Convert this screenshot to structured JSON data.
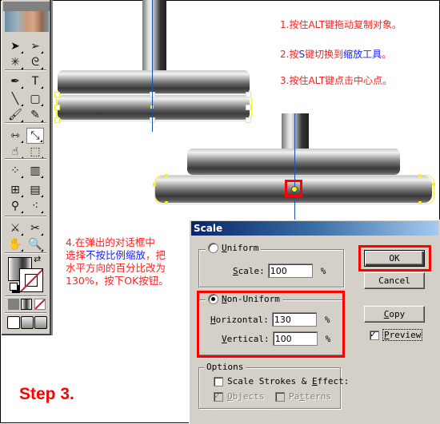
{
  "instructions": {
    "step1": "1.按住ALT键拖动复制对象。",
    "step2_prefix": "2.按",
    "step2_key": "S",
    "step2_mid": "键切换到",
    "step2_tool": "缩放工具",
    "step2_suffix": "。",
    "step3": "3.按住ALT键点击中心点。",
    "step4_line1": "4.在弹出的对话框中",
    "step4_line2_prefix": "选择",
    "step4_line2_highlight": "不按比例缩放",
    "step4_line2_suffix": "，把",
    "step4_line3": "水平方向的百分比改为",
    "step4_line4": "130%，按下OK按钮。"
  },
  "step_label": "Step 3.",
  "toolbox": {
    "tools": [
      {
        "name": "selection-tool",
        "glyph": "➤"
      },
      {
        "name": "direct-selection-tool",
        "glyph": "➢"
      },
      {
        "name": "magic-wand-tool",
        "glyph": "✳"
      },
      {
        "name": "lasso-tool",
        "glyph": "ᘓ"
      },
      {
        "name": "pen-tool",
        "glyph": "✒"
      },
      {
        "name": "type-tool",
        "glyph": "T"
      },
      {
        "name": "line-tool",
        "glyph": "╲"
      },
      {
        "name": "rounded-rectangle-tool",
        "glyph": "▢"
      },
      {
        "name": "paintbrush-tool",
        "glyph": "🖌"
      },
      {
        "name": "pencil-tool",
        "glyph": "✎"
      },
      {
        "name": "reflect-tool",
        "glyph": "⇿"
      },
      {
        "name": "scale-tool",
        "glyph": "⤡"
      },
      {
        "name": "warp-tool",
        "glyph": "☝"
      },
      {
        "name": "free-transform-tool",
        "glyph": "⬚"
      },
      {
        "name": "symbol-sprayer-tool",
        "glyph": "⁘"
      },
      {
        "name": "column-graph-tool",
        "glyph": "▥"
      },
      {
        "name": "mesh-tool",
        "glyph": "⊞"
      },
      {
        "name": "gradient-tool",
        "glyph": "▤"
      },
      {
        "name": "eyedropper-tool",
        "glyph": "⚲"
      },
      {
        "name": "blend-tool",
        "glyph": "⁖"
      },
      {
        "name": "slice-tool",
        "glyph": "⚔"
      },
      {
        "name": "scissors-tool",
        "glyph": "✂"
      },
      {
        "name": "hand-tool",
        "glyph": "✋"
      },
      {
        "name": "zoom-tool",
        "glyph": "🔍"
      }
    ],
    "active_tool": "scale-tool"
  },
  "dialog": {
    "title": "Scale",
    "uniform": {
      "label_u": "U",
      "label_rest": "niform",
      "selected": false,
      "scale_label_u": "S",
      "scale_label_rest": "cale:",
      "scale_value": "100",
      "unit": "%"
    },
    "non_uniform": {
      "label_u": "N",
      "label_rest": "on-Uniform",
      "selected": true,
      "horizontal_label_u": "H",
      "horizontal_label_rest": "orizontal:",
      "horizontal_value": "130",
      "vertical_label_u": "V",
      "vertical_label_rest": "ertical:",
      "vertical_value": "100",
      "unit": "%"
    },
    "options": {
      "title": "Options",
      "scale_strokes_prefix": "Scale Strokes & ",
      "scale_strokes_u": "E",
      "scale_strokes_suffix": "ffect:",
      "scale_strokes_checked": false,
      "objects_u": "O",
      "objects_rest": "bjects",
      "objects_checked": true,
      "objects_enabled": false,
      "patterns_pre": "Pa",
      "patterns_u": "t",
      "patterns_rest": "terns",
      "patterns_checked": false,
      "patterns_enabled": false
    },
    "buttons": {
      "ok": "OK",
      "cancel": "Cancel",
      "copy_u": "C",
      "copy_rest": "opy",
      "preview_u": "P",
      "preview_rest": "review",
      "preview_checked": true
    }
  },
  "colors": {
    "annotation_red": "#ff0000",
    "annotation_blue": "#2020ff",
    "selection_yellow": "#f5f02a",
    "guide_blue": "#1e50b0",
    "title_bar_start": "#0a246a",
    "title_bar_end": "#a6caf0"
  }
}
